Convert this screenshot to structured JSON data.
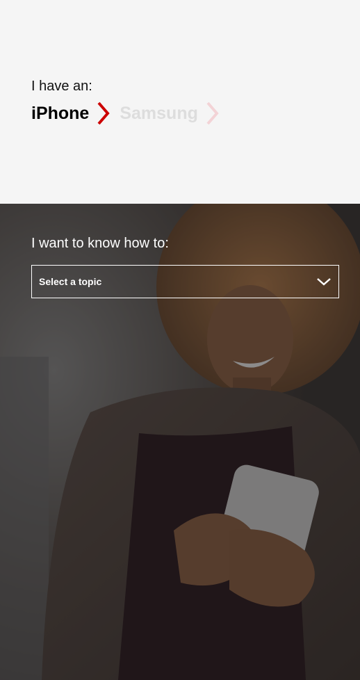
{
  "device_picker": {
    "label": "I have an:",
    "options": [
      {
        "label": "iPhone",
        "selected": true
      },
      {
        "label": "Samsung",
        "selected": false
      }
    ],
    "active_chevron_color": "#cc0000",
    "inactive_chevron_color": "#f3d3d6"
  },
  "topic": {
    "label": "I want to know how to:",
    "select_placeholder": "Select a topic",
    "chevron_icon": "chevron-down-icon"
  },
  "hero": {
    "image": "woman-smiling-at-phone"
  }
}
